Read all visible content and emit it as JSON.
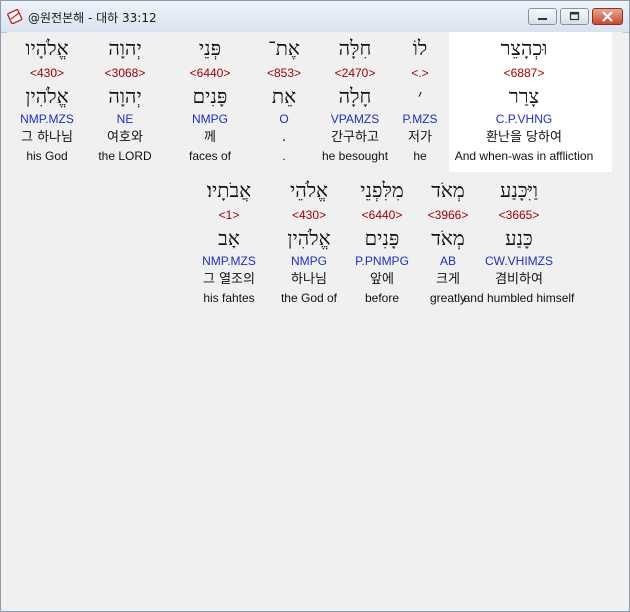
{
  "window": {
    "title": "@원전본해 - 대하 33:12"
  },
  "colors": {
    "strong": "#a00000",
    "morph": "#1f2fbf",
    "highlight": "#ffffff"
  },
  "rows": [
    {
      "words": [
        {
          "heb": "וּכְהָצֵר",
          "strong": "<6887>",
          "lemma": "צָרַר",
          "morph": "C.P.VHNG",
          "kor": "환난을 당하여",
          "eng": "And when-was in affliction"
        },
        {
          "heb": "לוֹ",
          "strong": "<.>",
          "lemma": "׳",
          "morph": "P.MZS",
          "kor": "저가",
          "eng": "he"
        },
        {
          "heb": "חִלָּה",
          "strong": "<2470>",
          "lemma": "חָלָה",
          "morph": "VPAMZS",
          "kor": "간구하고",
          "eng": "he besought"
        },
        {
          "heb": "אֶת־",
          "strong": "<853>",
          "lemma": "אֵת",
          "morph": "O",
          "kor": ".",
          "eng": "."
        },
        {
          "heb": "פְּנֵי",
          "strong": "<6440>",
          "lemma": "פָּנִים",
          "morph": "NMPG",
          "kor": "께",
          "eng": "faces of"
        },
        {
          "heb": "יְהוָה",
          "strong": "<3068>",
          "lemma": "יְהוָה",
          "morph": "NE",
          "kor": "여호와",
          "eng": "the LORD"
        },
        {
          "heb": "אֱלֹהָיו",
          "strong": "<430>",
          "lemma": "אֱלֹהִין",
          "morph": "NMP.MZS",
          "kor": "그 하나님",
          "eng": "his God"
        }
      ]
    },
    {
      "words": [
        {
          "heb": "וַיִּכָּנַע",
          "strong": "<3665>",
          "lemma": "כָּנַע",
          "morph": "CW.VHIMZS",
          "kor": "겸비하여",
          "eng": "and humbled himself"
        },
        {
          "heb": "מְאֹד",
          "strong": "<3966>",
          "lemma": "מְאֹד",
          "morph": "AB",
          "kor": "크게",
          "eng": "greatly"
        },
        {
          "heb": "מִלִּפְנֵי",
          "strong": "<6440>",
          "lemma": "פָּנִים",
          "morph": "P.PNMPG",
          "kor": "앞에",
          "eng": "before"
        },
        {
          "heb": "אֱלֹהֵי",
          "strong": "<430>",
          "lemma": "אֱלֹהִין",
          "morph": "NMPG",
          "kor": "하나님",
          "eng": "the God of"
        },
        {
          "heb": "אֲבֹתָיו׃",
          "strong": "<1>",
          "lemma": "אָב",
          "morph": "NMP.MZS",
          "kor": "그 열조의",
          "eng": "his fahtes"
        }
      ]
    }
  ]
}
